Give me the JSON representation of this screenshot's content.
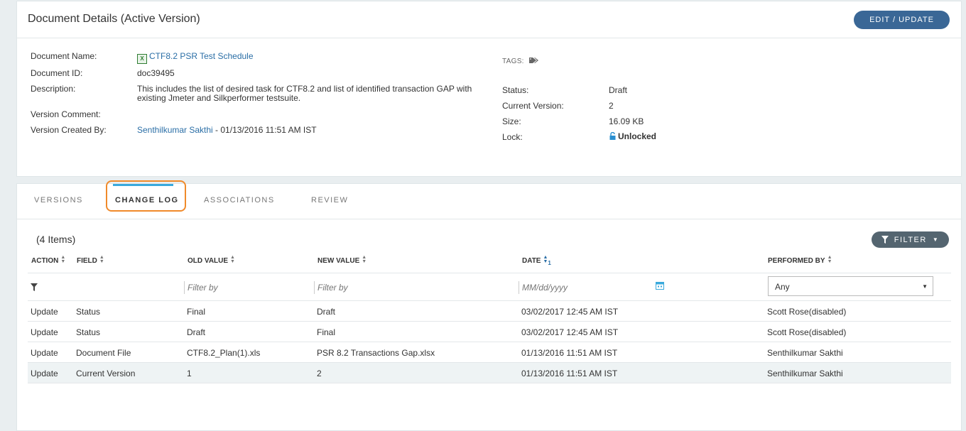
{
  "header": {
    "title": "Document Details (Active Version)",
    "edit_button": "EDIT / UPDATE"
  },
  "details": {
    "name_label": "Document Name:",
    "name_value": "CTF8.2 PSR Test Schedule",
    "id_label": "Document ID:",
    "id_value": "doc39495",
    "desc_label": "Description:",
    "desc_value": "This includes the list of desired task for CTF8.2 and list of identified transaction GAP with existing Jmeter and Silkperformer testsuite.",
    "comment_label": "Version Comment:",
    "created_label": "Version Created By:",
    "created_user": "Senthilkumar Sakthi",
    "created_date": " - 01/13/2016 11:51 AM IST",
    "tags_label": "TAGS:",
    "status_label": "Status:",
    "status_value": "Draft",
    "version_label": "Current Version:",
    "version_value": "2",
    "size_label": "Size:",
    "size_value": "16.09 KB",
    "lock_label": "Lock:",
    "lock_value": "Unlocked"
  },
  "tabs": [
    {
      "label": "VERSIONS",
      "active": false
    },
    {
      "label": "CHANGE LOG",
      "active": true
    },
    {
      "label": "ASSOCIATIONS",
      "active": false
    },
    {
      "label": "REVIEW",
      "active": false
    }
  ],
  "changelog": {
    "count": "(4 Items)",
    "filter_button": "FILTER",
    "columns": [
      "ACTION",
      "FIELD",
      "OLD VALUE",
      "NEW VALUE",
      "DATE",
      "PERFORMED BY"
    ],
    "date_sort_index": "1",
    "filters": {
      "old_placeholder": "Filter by",
      "new_placeholder": "Filter by",
      "date_placeholder": "MM/dd/yyyy",
      "performed_by": "Any"
    },
    "rows": [
      {
        "action": "Update",
        "field": "Status",
        "old": "Final",
        "new": "Draft",
        "date": "03/02/2017 12:45 AM IST",
        "by": "Scott Rose(disabled)"
      },
      {
        "action": "Update",
        "field": "Status",
        "old": "Draft",
        "new": "Final",
        "date": "03/02/2017 12:45 AM IST",
        "by": "Scott Rose(disabled)"
      },
      {
        "action": "Update",
        "field": "Document File",
        "old": "CTF8.2_Plan(1).xls",
        "new": "PSR 8.2 Transactions Gap.xlsx",
        "date": "01/13/2016 11:51 AM IST",
        "by": "Senthilkumar Sakthi"
      },
      {
        "action": "Update",
        "field": "Current Version",
        "old": "1",
        "new": "2",
        "date": "01/13/2016 11:51 AM IST",
        "by": "Senthilkumar Sakthi"
      }
    ]
  },
  "colors": {
    "primary_button": "#3a6796",
    "filter_button": "#546570",
    "link": "#2a6ea6",
    "tab_underline": "#3aa9dc",
    "highlight": "#f08a2a"
  }
}
